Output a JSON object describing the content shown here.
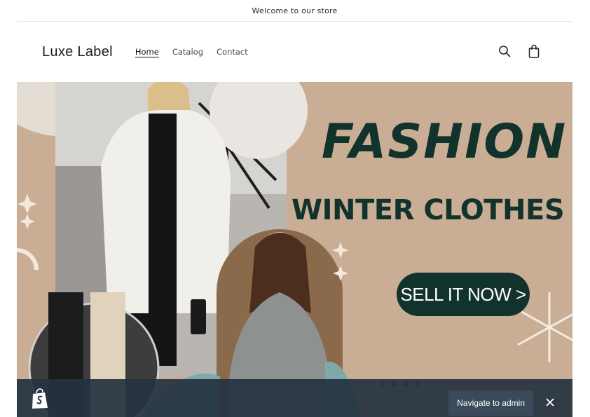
{
  "announcement": {
    "text": "Welcome to our store"
  },
  "header": {
    "logo": "Luxe Label",
    "nav": [
      {
        "label": "Home",
        "active": true
      },
      {
        "label": "Catalog",
        "active": false
      },
      {
        "label": "Contact",
        "active": false
      }
    ],
    "icons": [
      "search-icon",
      "cart-icon"
    ]
  },
  "hero": {
    "headline": "FASHION",
    "subheadline": "WINTER CLOTHES",
    "cta": "SELL IT NOW >",
    "colors": {
      "background": "#c9ae95",
      "text": "#12332b",
      "button": "#12332b"
    }
  },
  "admin_bar": {
    "button_label": "Navigate to admin",
    "icons": [
      "shopify-bag-icon",
      "close-icon"
    ],
    "color": "#253240"
  }
}
